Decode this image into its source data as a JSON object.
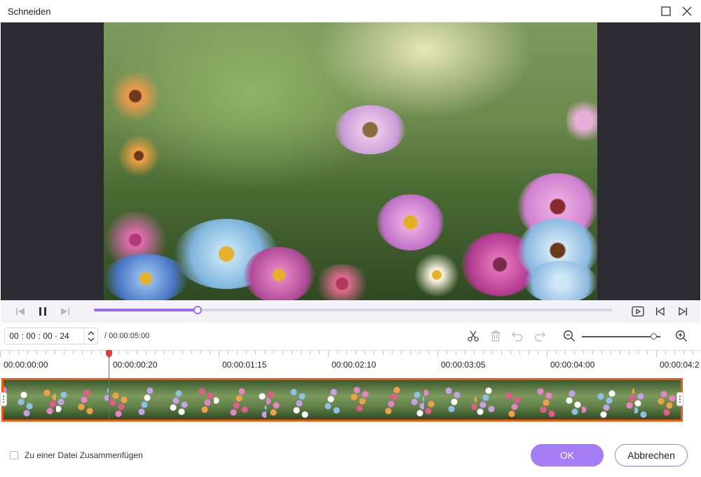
{
  "window": {
    "title": "Schneiden",
    "maximize_icon": "maximize-icon",
    "close_icon": "close-icon"
  },
  "player": {
    "progress": 0.2,
    "controls": [
      "previous-frame-icon",
      "pause-icon",
      "next-frame-icon",
      "play-segment-icon",
      "jump-to-start-icon",
      "jump-to-end-icon"
    ]
  },
  "editor": {
    "current_time": {
      "hours": "00",
      "minutes": "00",
      "seconds": "00",
      "frames": "24"
    },
    "total_time": "/ 00:00:05:00",
    "tools": [
      "scissors-icon",
      "delete-icon",
      "undo-icon",
      "redo-icon",
      "zoom-out-icon",
      "zoom-in-icon"
    ],
    "zoom_level": 0.92
  },
  "timeline": {
    "labels": [
      "00:00:00:00",
      "00:00:00:20",
      "00:00:01:15",
      "00:00:02:10",
      "00:00:03:05",
      "00:00:04:00",
      "00:00:04:2"
    ],
    "playhead_position": 0.2,
    "selection_color": "#ee5a12"
  },
  "footer": {
    "merge_label": "Zu einer Datei Zusammenfügen",
    "merge_checked": false,
    "ok_label": "OK",
    "cancel_label": "Abbrechen"
  },
  "colors": {
    "accent": "#a47cf3",
    "playhead": "#e53a3a"
  }
}
